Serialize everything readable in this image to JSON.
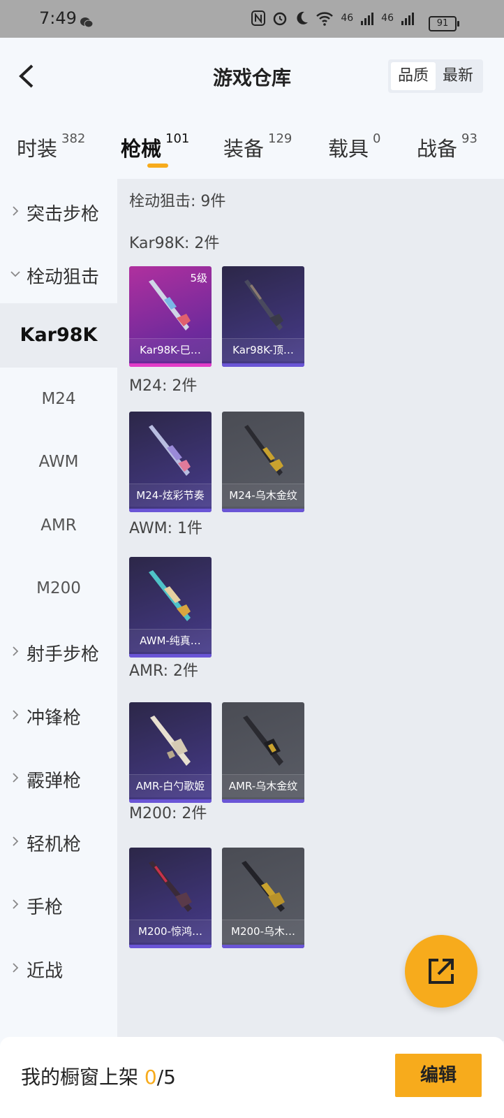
{
  "status_bar": {
    "time": "7:49",
    "signal_a": "46",
    "signal_b": "46",
    "battery": "91"
  },
  "header": {
    "title": "游戏仓库",
    "sort_quality": "品质",
    "sort_newest": "最新"
  },
  "tabs": [
    {
      "label": "时装",
      "count": "382"
    },
    {
      "label": "枪械",
      "count": "101"
    },
    {
      "label": "装备",
      "count": "129"
    },
    {
      "label": "载具",
      "count": "0"
    },
    {
      "label": "战备",
      "count": "93"
    }
  ],
  "sidebar": {
    "items": [
      {
        "label": "突击步枪"
      },
      {
        "label": "栓动狙击"
      },
      {
        "label": "射手步枪"
      },
      {
        "label": "冲锋枪"
      },
      {
        "label": "霰弹枪"
      },
      {
        "label": "轻机枪"
      },
      {
        "label": "手枪"
      },
      {
        "label": "近战"
      }
    ],
    "subitems": [
      {
        "label": "Kar98K"
      },
      {
        "label": "M24"
      },
      {
        "label": "AWM"
      },
      {
        "label": "AMR"
      },
      {
        "label": "M200"
      }
    ]
  },
  "content": {
    "category_title": "栓动狙击: 9件",
    "groups": [
      {
        "title": "Kar98K: 2件",
        "items": [
          {
            "name": "Kar98K-巳…",
            "level": "5级"
          },
          {
            "name": "Kar98K-顶…"
          }
        ]
      },
      {
        "title": "M24: 2件",
        "items": [
          {
            "name": "M24-炫彩节奏"
          },
          {
            "name": "M24-乌木金纹"
          }
        ]
      },
      {
        "title": "AWM: 1件",
        "items": [
          {
            "name": "AWM-纯真…"
          }
        ]
      },
      {
        "title": "AMR: 2件",
        "items": [
          {
            "name": "AMR-白勺歌姬"
          },
          {
            "name": "AMR-乌木金纹"
          }
        ]
      },
      {
        "title": "M200: 2件",
        "items": [
          {
            "name": "M200-惊鸿…"
          },
          {
            "name": "M200-乌木…"
          }
        ]
      }
    ]
  },
  "footer": {
    "label_prefix": "我的橱窗上架 ",
    "count_current": "0",
    "count_total": "/5",
    "edit_label": "编辑"
  },
  "colors": {
    "accent": "#f7ab1c",
    "rarity_purple": "#6a55d6",
    "rarity_pink": "#d23cc4",
    "rarity_gray": "#5a5d66"
  }
}
